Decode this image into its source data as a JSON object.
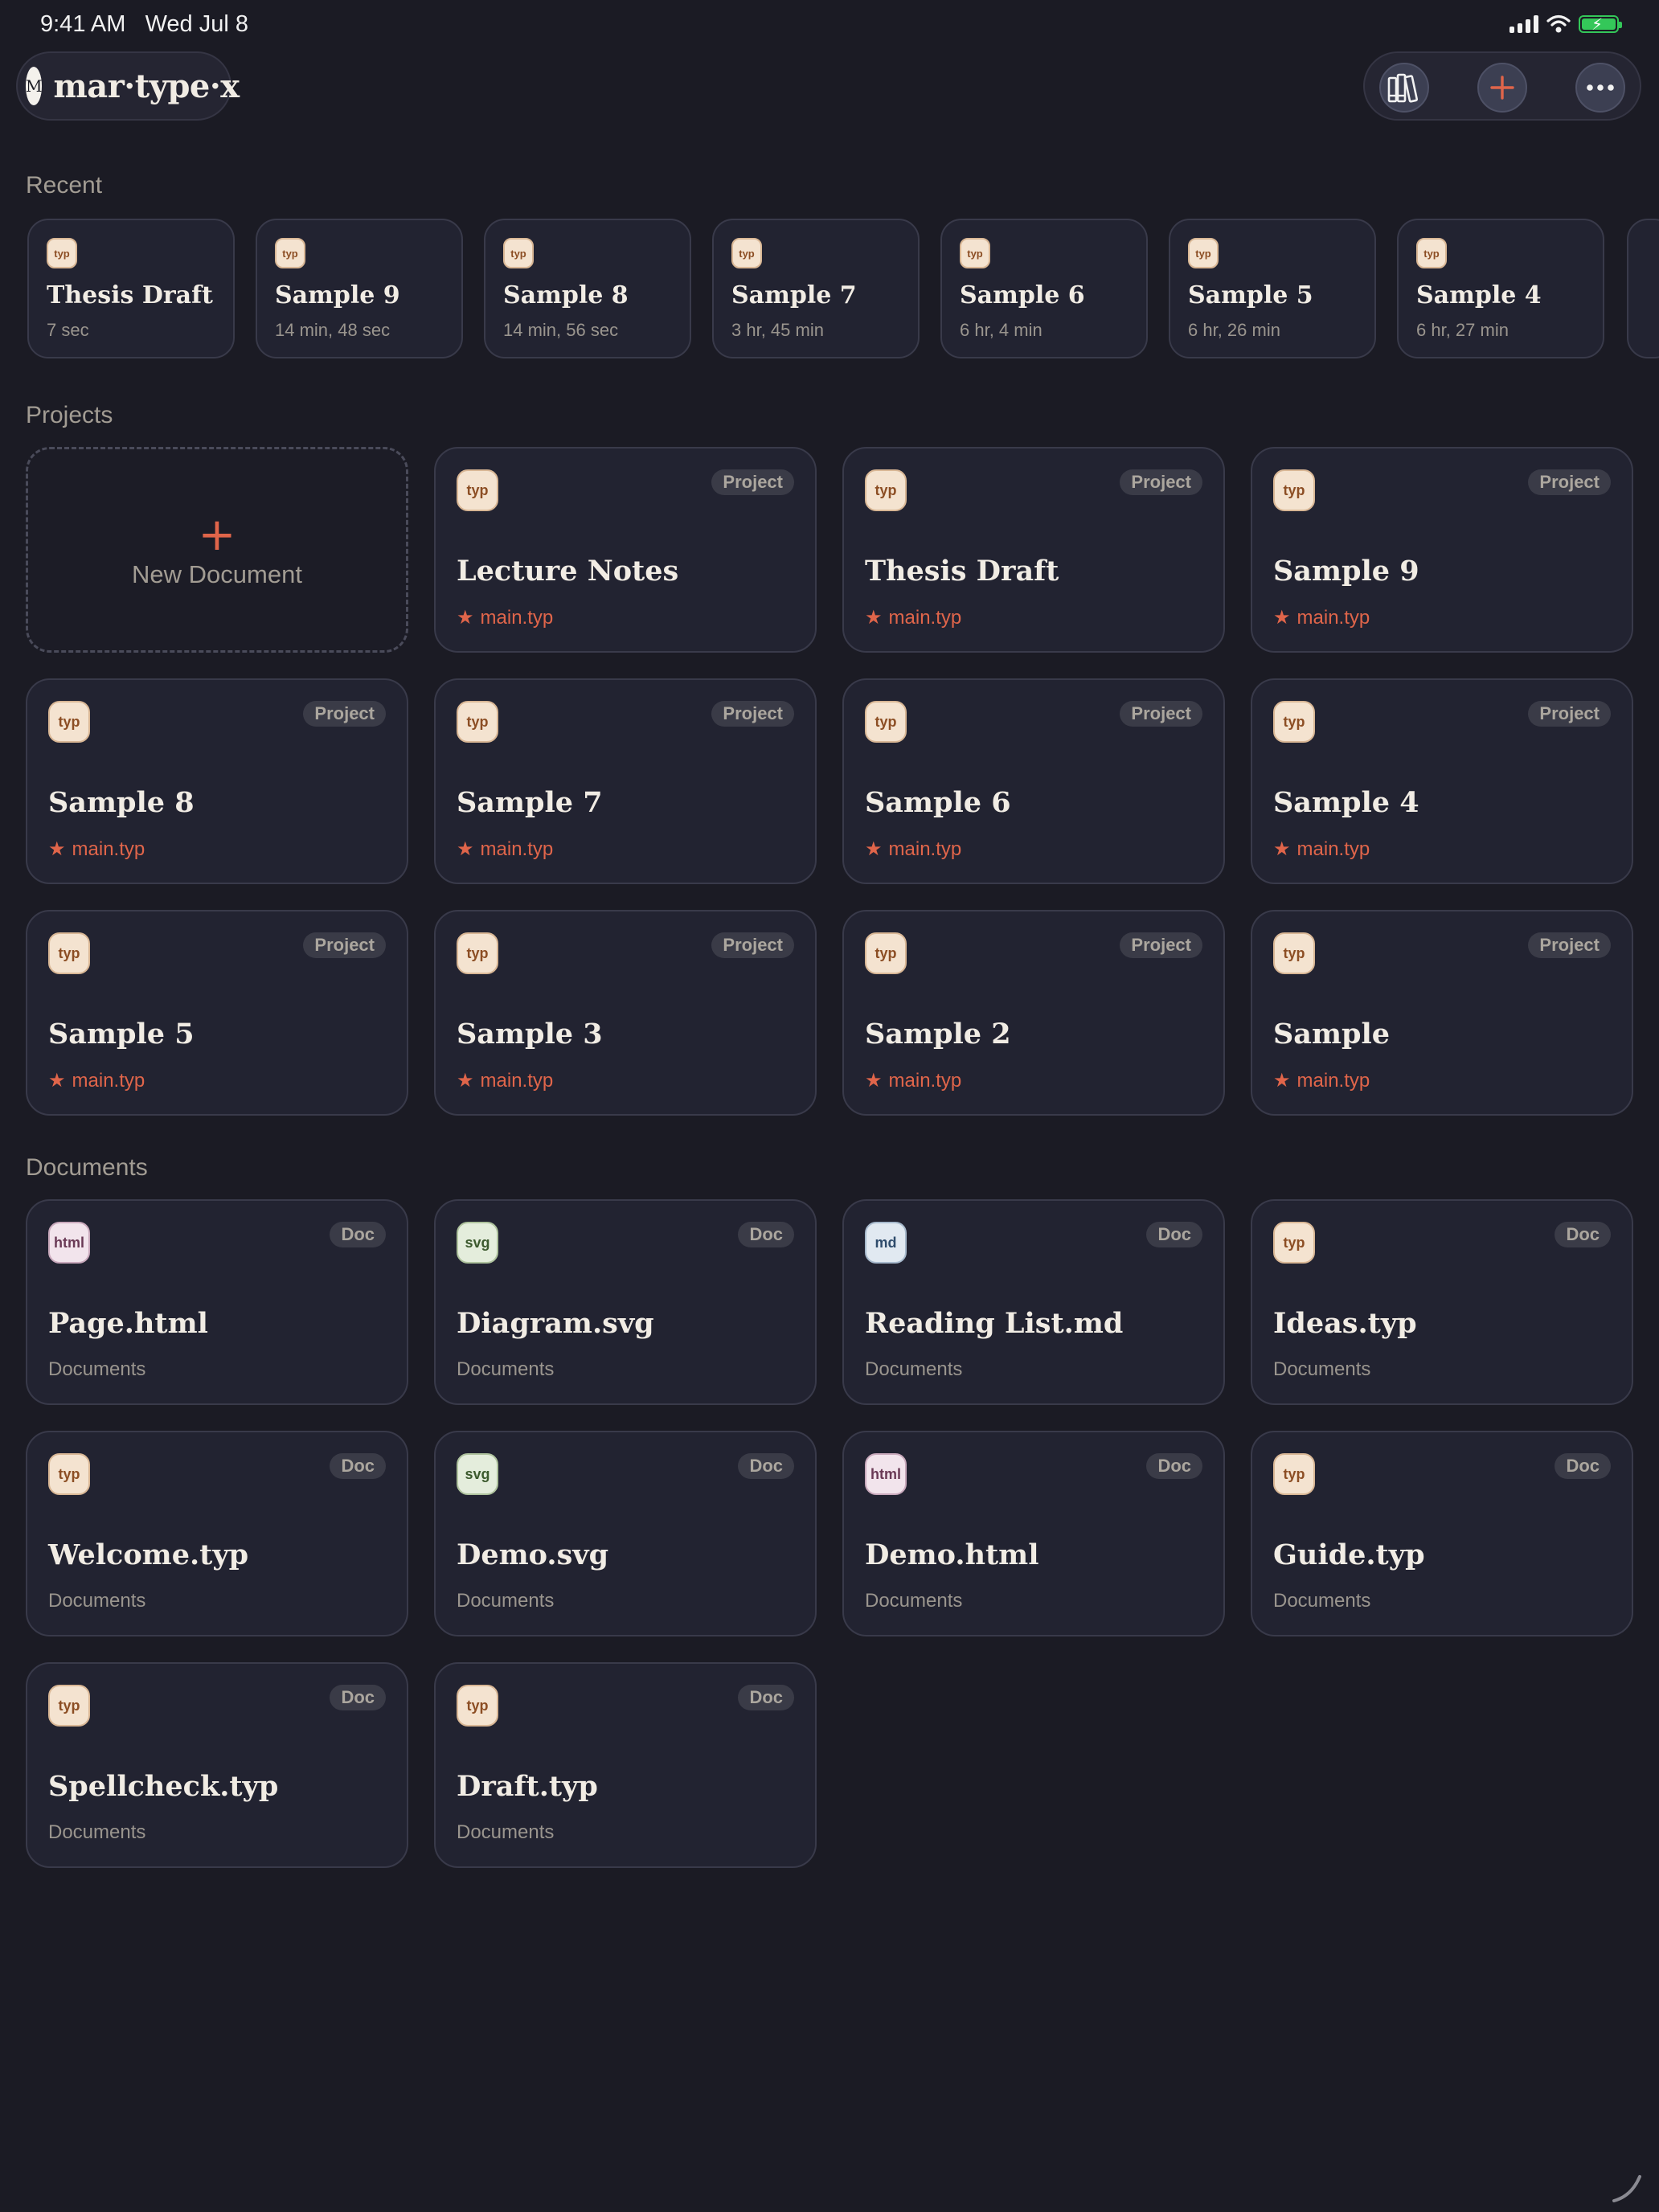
{
  "status_bar": {
    "time": "9:41 AM",
    "date": "Wed Jul 8"
  },
  "app": {
    "logo_mark": "M",
    "logo_text": "mar·type·x"
  },
  "toolbar": {
    "library_icon": "books-icon",
    "add_icon": "plus-icon",
    "more_icon": "ellipsis-icon"
  },
  "colors": {
    "background": "#1b1b24",
    "card": "#222331",
    "accent": "#e0654a",
    "battery": "#34c759"
  },
  "sections": {
    "recent": "Recent",
    "projects": "Projects",
    "documents": "Documents"
  },
  "recent": [
    {
      "icon": "typ",
      "title": "Thesis Draft",
      "time": "7 sec"
    },
    {
      "icon": "typ",
      "title": "Sample 9",
      "time": "14 min, 48 sec"
    },
    {
      "icon": "typ",
      "title": "Sample 8",
      "time": "14 min, 56 sec"
    },
    {
      "icon": "typ",
      "title": "Sample 7",
      "time": "3 hr, 45 min"
    },
    {
      "icon": "typ",
      "title": "Sample 6",
      "time": "6 hr, 4 min"
    },
    {
      "icon": "typ",
      "title": "Sample 5",
      "time": "6 hr, 26 min"
    },
    {
      "icon": "typ",
      "title": "Sample 4",
      "time": "6 hr, 27 min"
    }
  ],
  "new_document": {
    "plus": "+",
    "label": "New Document"
  },
  "projects": [
    {
      "icon": "typ",
      "badge": "Project",
      "title": "Lecture Notes",
      "file": "main.typ"
    },
    {
      "icon": "typ",
      "badge": "Project",
      "title": "Thesis Draft",
      "file": "main.typ"
    },
    {
      "icon": "typ",
      "badge": "Project",
      "title": "Sample 9",
      "file": "main.typ"
    },
    {
      "icon": "typ",
      "badge": "Project",
      "title": "Sample 8",
      "file": "main.typ"
    },
    {
      "icon": "typ",
      "badge": "Project",
      "title": "Sample 7",
      "file": "main.typ"
    },
    {
      "icon": "typ",
      "badge": "Project",
      "title": "Sample 6",
      "file": "main.typ"
    },
    {
      "icon": "typ",
      "badge": "Project",
      "title": "Sample 4",
      "file": "main.typ"
    },
    {
      "icon": "typ",
      "badge": "Project",
      "title": "Sample 5",
      "file": "main.typ"
    },
    {
      "icon": "typ",
      "badge": "Project",
      "title": "Sample 3",
      "file": "main.typ"
    },
    {
      "icon": "typ",
      "badge": "Project",
      "title": "Sample 2",
      "file": "main.typ"
    },
    {
      "icon": "typ",
      "badge": "Project",
      "title": "Sample",
      "file": "main.typ"
    }
  ],
  "documents": [
    {
      "icon": "html",
      "badge": "Doc",
      "title": "Page.html",
      "location": "Documents"
    },
    {
      "icon": "svg",
      "badge": "Doc",
      "title": "Diagram.svg",
      "location": "Documents"
    },
    {
      "icon": "md",
      "badge": "Doc",
      "title": "Reading List.md",
      "location": "Documents"
    },
    {
      "icon": "typ",
      "badge": "Doc",
      "title": "Ideas.typ",
      "location": "Documents"
    },
    {
      "icon": "typ",
      "badge": "Doc",
      "title": "Welcome.typ",
      "location": "Documents"
    },
    {
      "icon": "svg",
      "badge": "Doc",
      "title": "Demo.svg",
      "location": "Documents"
    },
    {
      "icon": "html",
      "badge": "Doc",
      "title": "Demo.html",
      "location": "Documents"
    },
    {
      "icon": "typ",
      "badge": "Doc",
      "title": "Guide.typ",
      "location": "Documents"
    },
    {
      "icon": "typ",
      "badge": "Doc",
      "title": "Spellcheck.typ",
      "location": "Documents"
    },
    {
      "icon": "typ",
      "badge": "Doc",
      "title": "Draft.typ",
      "location": "Documents"
    }
  ]
}
